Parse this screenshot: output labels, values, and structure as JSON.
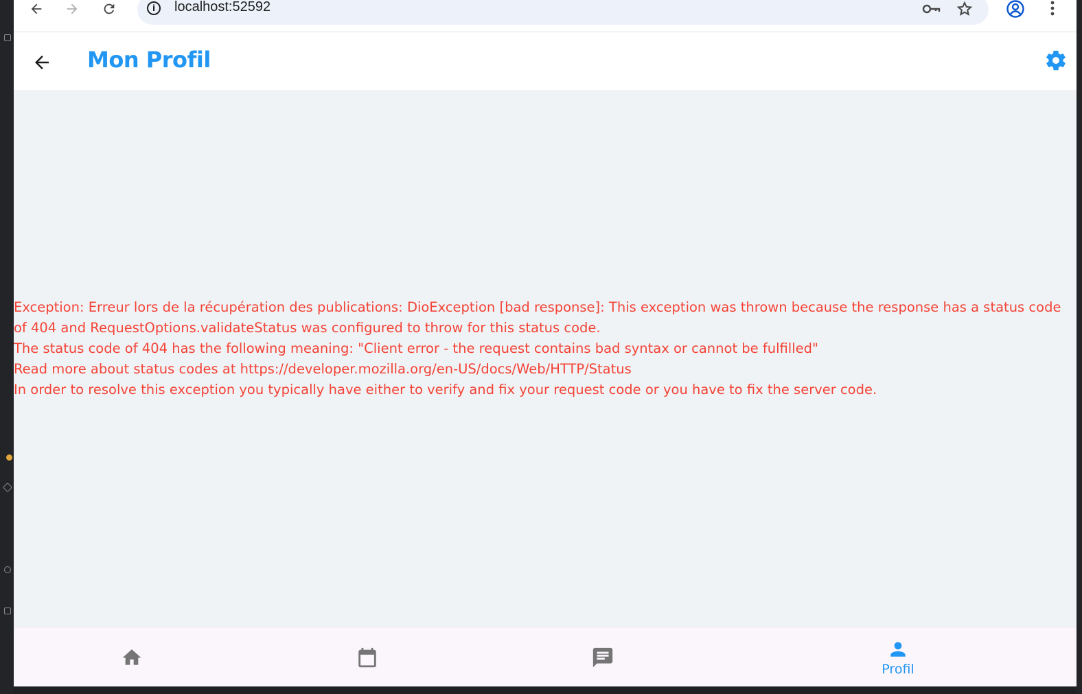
{
  "browser": {
    "url": "localhost:52592"
  },
  "appbar": {
    "title": "Mon Profil"
  },
  "error": {
    "message": "Exception: Erreur lors de la récupération des publications: DioException [bad response]: This exception was thrown because the response has a status code of 404 and RequestOptions.validateStatus was configured to throw for this status code.\nThe status code of 404 has the following meaning: \"Client error - the request contains bad syntax or cannot be fulfilled\"\nRead more about status codes at https://developer.mozilla.org/en-US/docs/Web/HTTP/Status\nIn order to resolve this exception you typically have either to verify and fix your request code or you have to fix the server code."
  },
  "bottom_nav": {
    "items": [
      {
        "icon": "home-icon",
        "label": ""
      },
      {
        "icon": "calendar-icon",
        "label": ""
      },
      {
        "icon": "chat-icon",
        "label": ""
      },
      {
        "icon": "person-icon",
        "label": "Profil"
      }
    ],
    "active_color": "#2196f3",
    "inactive_color": "#757575"
  },
  "colors": {
    "accent": "#2196f3",
    "error": "#f44336",
    "background": "#f0f3f6"
  }
}
